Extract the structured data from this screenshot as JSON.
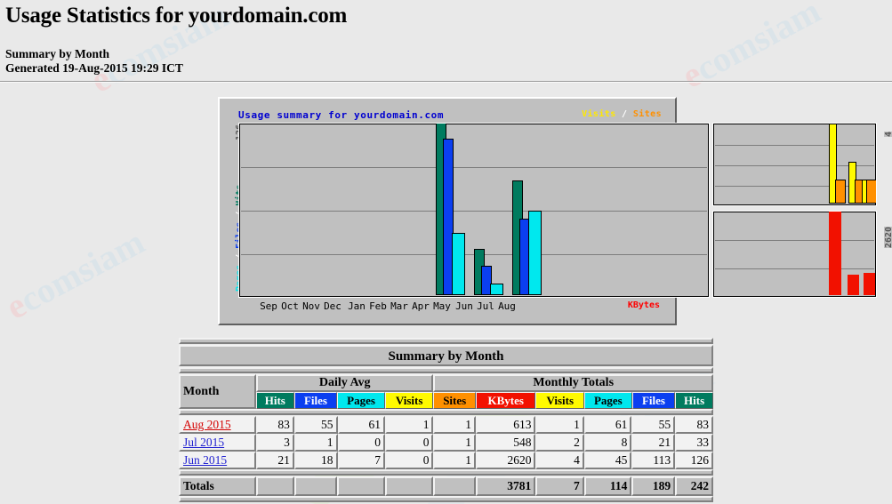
{
  "page": {
    "title": "Usage Statistics for yourdomain.com",
    "summary_line": "Summary by Month",
    "generated_line": "Generated 19-Aug-2015 19:29 ICT",
    "background_color": "#e9e9e9",
    "watermark_text": "ecomsiam"
  },
  "chart": {
    "title": "Usage summary for yourdomain.com",
    "legend": {
      "visits": "Visits",
      "separator": "/",
      "sites": "Sites"
    },
    "left_axis_max_label": "126",
    "left_axis_title_parts": [
      {
        "text": "Pages",
        "color": "#00e8ee"
      },
      {
        "text": " / ",
        "color": "#ffffff"
      },
      {
        "text": "Files",
        "color": "#0b3ff0"
      },
      {
        "text": " / ",
        "color": "#ffffff"
      },
      {
        "text": "Hits",
        "color": "#007b5f"
      }
    ],
    "right_top_axis_max_label": "4",
    "right_bottom_axis_max_label": "2620",
    "kbytes_label": "KBytes",
    "month_labels": [
      "Sep",
      "Oct",
      "Nov",
      "Dec",
      "Jan",
      "Feb",
      "Mar",
      "Apr",
      "May",
      "Jun",
      "Jul",
      "Aug"
    ]
  },
  "chart_data": {
    "type": "bar",
    "title": "Usage summary for yourdomain.com",
    "xlabel": "",
    "ylabel": "Pages / Files / Hits",
    "categories": [
      "Sep",
      "Oct",
      "Nov",
      "Dec",
      "Jan",
      "Feb",
      "Mar",
      "Apr",
      "May",
      "Jun",
      "Jul",
      "Aug"
    ],
    "grid": true,
    "legend_position": "top-right",
    "panels": [
      {
        "name": "hits-files-pages",
        "ylim": [
          0,
          126
        ],
        "ymax_label": "126",
        "series": [
          {
            "name": "Hits",
            "color": "#007b5f",
            "values": [
              0,
              0,
              0,
              0,
              0,
              0,
              0,
              0,
              0,
              126,
              33,
              83
            ]
          },
          {
            "name": "Files",
            "color": "#0b3ff0",
            "values": [
              0,
              0,
              0,
              0,
              0,
              0,
              0,
              0,
              0,
              113,
              21,
              55
            ]
          },
          {
            "name": "Pages",
            "color": "#00e8ee",
            "values": [
              0,
              0,
              0,
              0,
              0,
              0,
              0,
              0,
              0,
              45,
              8,
              61
            ]
          }
        ]
      },
      {
        "name": "visits-sites",
        "ylim": [
          0,
          4
        ],
        "ymax_label": "4",
        "series": [
          {
            "name": "Visits",
            "color": "#fffa00",
            "values": [
              0,
              0,
              0,
              0,
              0,
              0,
              0,
              0,
              0,
              4,
              2,
              1
            ]
          },
          {
            "name": "Sites",
            "color": "#ff9000",
            "values": [
              0,
              0,
              0,
              0,
              0,
              0,
              0,
              0,
              0,
              1,
              1,
              1
            ]
          }
        ]
      },
      {
        "name": "kbytes",
        "ylim": [
          0,
          2620
        ],
        "ymax_label": "2620",
        "series": [
          {
            "name": "KBytes",
            "color": "#f21100",
            "values": [
              0,
              0,
              0,
              0,
              0,
              0,
              0,
              0,
              0,
              2620,
              548,
              613
            ]
          }
        ]
      }
    ]
  },
  "table": {
    "caption": "Summary by Month",
    "month_header": "Month",
    "group_headers": [
      {
        "label": "Daily Avg",
        "span": 4
      },
      {
        "label": "Monthly Totals",
        "span": 6
      }
    ],
    "column_headers": [
      {
        "label": "Hits",
        "key": "avg_hits",
        "class": "c-hits"
      },
      {
        "label": "Files",
        "key": "avg_files",
        "class": "c-files"
      },
      {
        "label": "Pages",
        "key": "avg_pages",
        "class": "c-pages"
      },
      {
        "label": "Visits",
        "key": "avg_visits",
        "class": "c-visits"
      },
      {
        "label": "Sites",
        "key": "tot_sites",
        "class": "c-sites"
      },
      {
        "label": "KBytes",
        "key": "tot_kbytes",
        "class": "c-kbytes"
      },
      {
        "label": "Visits",
        "key": "tot_visits",
        "class": "c-visits"
      },
      {
        "label": "Pages",
        "key": "tot_pages",
        "class": "c-pages"
      },
      {
        "label": "Files",
        "key": "tot_files",
        "class": "c-files"
      },
      {
        "label": "Hits",
        "key": "tot_hits",
        "class": "c-hits"
      }
    ],
    "rows": [
      {
        "month": "Aug 2015",
        "link_state": "current",
        "avg_hits": "83",
        "avg_files": "55",
        "avg_pages": "61",
        "avg_visits": "1",
        "tot_sites": "1",
        "tot_kbytes": "613",
        "tot_visits": "1",
        "tot_pages": "61",
        "tot_files": "55",
        "tot_hits": "83"
      },
      {
        "month": "Jul 2015",
        "link_state": "old",
        "avg_hits": "3",
        "avg_files": "1",
        "avg_pages": "0",
        "avg_visits": "0",
        "tot_sites": "1",
        "tot_kbytes": "548",
        "tot_visits": "2",
        "tot_pages": "8",
        "tot_files": "21",
        "tot_hits": "33"
      },
      {
        "month": "Jun 2015",
        "link_state": "old",
        "avg_hits": "21",
        "avg_files": "18",
        "avg_pages": "7",
        "avg_visits": "0",
        "tot_sites": "1",
        "tot_kbytes": "2620",
        "tot_visits": "4",
        "tot_pages": "45",
        "tot_files": "113",
        "tot_hits": "126"
      }
    ],
    "totals": {
      "label": "Totals",
      "avg_hits": "",
      "avg_files": "",
      "avg_pages": "",
      "avg_visits": "",
      "tot_sites": "",
      "tot_kbytes": "3781",
      "tot_visits": "7",
      "tot_pages": "114",
      "tot_files": "189",
      "tot_hits": "242"
    }
  }
}
